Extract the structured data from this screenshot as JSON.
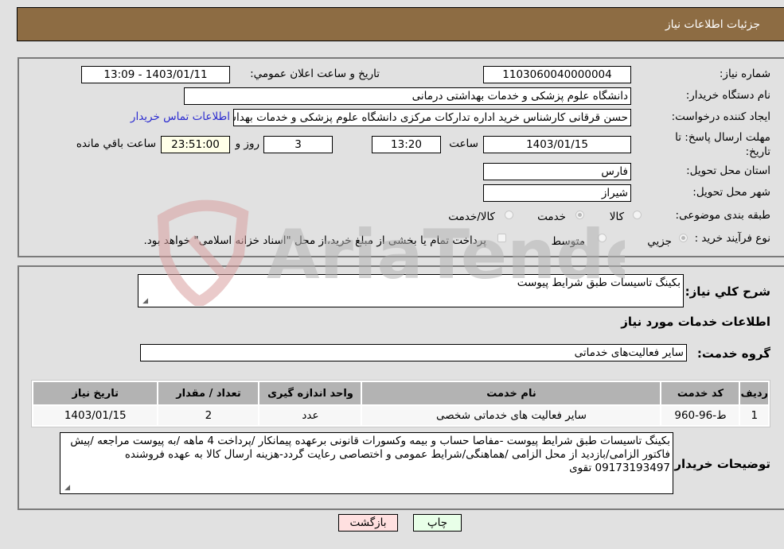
{
  "header": {
    "title": "جزئیات اطلاعات نیاز"
  },
  "fields": {
    "need_number": {
      "label": "شماره نیاز:",
      "value": "1103060040000004"
    },
    "announce_datetime": {
      "label": "تاریخ و ساعت اعلان عمومي:",
      "value": "1403/01/11 - 13:09"
    },
    "buyer_org": {
      "label": "نام دستگاه خریدار:",
      "value": "دانشگاه علوم پزشکی و خدمات بهداشتی درمانی"
    },
    "requester": {
      "label": "ایجاد کننده درخواست:",
      "value": "حسن قرقانی کارشناس خرید اداره تدارکات مرکزی دانشگاه علوم پزشکی و خدمات بهداشتی درمانی"
    },
    "buyer_contact_link": "اطلاعات تماس خریدار",
    "deadline": {
      "label": "مهلت ارسال پاسخ: تا تاریخ:",
      "date": "1403/01/15",
      "time_label": "ساعت",
      "time": "13:20",
      "days": "3",
      "days_label": "روز و",
      "remaining": "23:51:00",
      "remaining_label": "ساعت باقي مانده"
    },
    "province": {
      "label": "استان محل تحویل:",
      "value": "فارس"
    },
    "city": {
      "label": "شهر محل تحویل:",
      "value": "شیراز"
    },
    "category": {
      "label": "طبقه بندی موضوعی:",
      "options": [
        "کالا",
        "خدمت",
        "کالا/خدمت"
      ],
      "selected": "خدمت"
    },
    "purchase_type": {
      "label": "نوع فرآیند خرید :",
      "options": [
        "جزيي",
        "متوسط"
      ],
      "selected": "جزيي",
      "treasury_note": "پرداخت تمام یا بخشی از مبلغ خرید،از محل \"اسناد خزانه اسلامی\" خواهد بود.",
      "treasury_checked": false
    }
  },
  "details": {
    "summary_label": "شرح کلي نیاز:",
    "summary_value": "بکینگ تاسیسات طبق شرایط پیوست",
    "services_heading": "اطلاعات خدمات مورد نیاز",
    "service_group_label": "گروه خدمت:",
    "service_group_value": "سایر فعالیت‌های خدماتی",
    "table": {
      "headers": [
        "ردیف",
        "کد خدمت",
        "نام خدمت",
        "واحد اندازه گیری",
        "تعداد / مقدار",
        "تاریخ نیاز"
      ],
      "rows": [
        [
          "1",
          "ط-96-960",
          "سایر فعالیت های خدماتی شخصی",
          "عدد",
          "2",
          "1403/01/15"
        ]
      ]
    },
    "buyer_notes_label": "توضیحات خریدار:",
    "buyer_notes_value": "بکینگ تاسیسات طبق شرایط پیوست -مفاصا حساب و بیمه وکسورات قانونی برعهده پیمانکار /پرداخت 4 ماهه /به پیوست مراجعه /پیش فاکتور الزامی/بازدید از محل الزامی /هماهنگی/شرایط عمومی و اختصاصی رعایت گردد-هزینه ارسال کالا به عهده فروشنده 09173193497 تقوی"
  },
  "buttons": {
    "print": "چاپ",
    "back": "بازگشت"
  },
  "watermark": {
    "text": "AriaTender.neT"
  },
  "colors": {
    "header_bg": "#8d6c43",
    "page_bg": "#e1e1e1",
    "table_header_bg": "#b3b3b3",
    "link": "#2a2ad0",
    "back_btn": "#ffe0e0",
    "print_btn": "#e8ffe8"
  }
}
